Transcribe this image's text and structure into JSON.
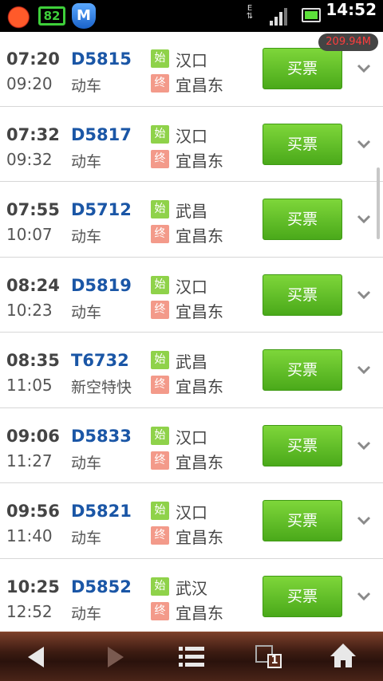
{
  "status_bar": {
    "time": "14:52",
    "network": "E",
    "app_badge": "82",
    "app_letter": "M"
  },
  "memory_badge": "209.94M",
  "buy_label": "买票",
  "start_badge": "始",
  "end_badge": "终",
  "trains": [
    {
      "dep": "07:20",
      "arr": "09:20",
      "no": "D5815",
      "type": "动车",
      "from": "汉口",
      "to": "宜昌东"
    },
    {
      "dep": "07:32",
      "arr": "09:32",
      "no": "D5817",
      "type": "动车",
      "from": "汉口",
      "to": "宜昌东"
    },
    {
      "dep": "07:55",
      "arr": "10:07",
      "no": "D5712",
      "type": "动车",
      "from": "武昌",
      "to": "宜昌东"
    },
    {
      "dep": "08:24",
      "arr": "10:23",
      "no": "D5819",
      "type": "动车",
      "from": "汉口",
      "to": "宜昌东"
    },
    {
      "dep": "08:35",
      "arr": "11:05",
      "no": "T6732",
      "type": "新空特快",
      "from": "武昌",
      "to": "宜昌东"
    },
    {
      "dep": "09:06",
      "arr": "11:27",
      "no": "D5833",
      "type": "动车",
      "from": "汉口",
      "to": "宜昌东"
    },
    {
      "dep": "09:56",
      "arr": "11:40",
      "no": "D5821",
      "type": "动车",
      "from": "汉口",
      "to": "宜昌东"
    },
    {
      "dep": "10:25",
      "arr": "12:52",
      "no": "D5852",
      "type": "动车",
      "from": "武汉",
      "to": "宜昌东"
    }
  ],
  "toolbar": {
    "window_count": "1"
  },
  "colors": {
    "train_number": "#1a56a6",
    "buy_button": "#5cb824",
    "start_badge": "#8fd24a",
    "end_badge": "#f39a8a",
    "memory_text": "#ff3d3d"
  }
}
